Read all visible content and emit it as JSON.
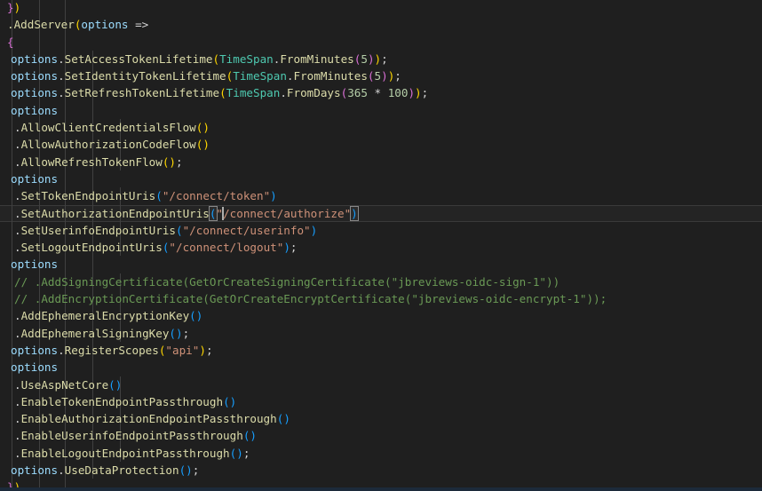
{
  "app": {
    "kind": "code-editor",
    "language": "csharp",
    "theme": "dark-modern",
    "background": "#1f1f1f",
    "foreground": "#d4d4d4"
  },
  "colors": {
    "variable": "#9cdcfe",
    "function": "#dcdcaa",
    "type": "#4ec9b0",
    "string": "#ce9178",
    "number": "#b5cea8",
    "comment": "#6a9955",
    "operator": "#d4d4d4",
    "bracket_level_0": "#ffd700",
    "bracket_level_1": "#da70d6",
    "bracket_level_2": "#179fff",
    "current_line_background": "#242424",
    "current_line_border": "#3a3a3a",
    "indent_guide": "#404040",
    "caret": "#aeafad",
    "status_strip": "#1c2a3a"
  },
  "cursor": {
    "line_index": 12,
    "line_text": ".SetAuthorizationEndpointUris(\"/connect/authorize\")",
    "bracket_match": [
      "(",
      ")"
    ],
    "caret_after": "\""
  },
  "indent_guides_x": [
    13,
    44,
    73,
    104,
    135
  ],
  "code": {
    "lines": [
      "})",
      ".AddServer(options =>",
      "{",
      "    options.SetAccessTokenLifetime(TimeSpan.FromMinutes(5));",
      "    options.SetIdentityTokenLifetime(TimeSpan.FromMinutes(5));",
      "    options.SetRefreshTokenLifetime(TimeSpan.FromDays(365 * 100));",
      "    options",
      "        .AllowClientCredentialsFlow()",
      "        .AllowAuthorizationCodeFlow()",
      "        .AllowRefreshTokenFlow();",
      "    options",
      "        .SetTokenEndpointUris(\"/connect/token\")",
      "        .SetAuthorizationEndpointUris(\"/connect/authorize\")",
      "        .SetUserinfoEndpointUris(\"/connect/userinfo\")",
      "        .SetLogoutEndpointUris(\"/connect/logout\");",
      "    options",
      "        // .AddSigningCertificate(GetOrCreateSigningCertificate(\"jbreviews-oidc-sign-1\"))",
      "        // .AddEncryptionCertificate(GetOrCreateEncryptCertificate(\"jbreviews-oidc-encrypt-1\"));",
      "        .AddEphemeralEncryptionKey()",
      "        .AddEphemeralSigningKey();",
      "    options.RegisterScopes(\"api\");",
      "    options",
      "        .UseAspNetCore()",
      "        .EnableTokenEndpointPassthrough()",
      "        .EnableAuthorizationEndpointPassthrough()",
      "        .EnableUserinfoEndpointPassthrough()",
      "        .EnableLogoutEndpointPassthrough();",
      "    options.UseDataProtection();",
      "})"
    ],
    "tokens": [
      [
        [
          "}",
          "b1"
        ],
        [
          ")",
          "b0"
        ]
      ],
      [
        [
          ".AddServer",
          "fn"
        ],
        [
          "(",
          "b0"
        ],
        [
          "options",
          "var"
        ],
        [
          " =>",
          "op"
        ]
      ],
      [
        [
          "{",
          "b1"
        ]
      ],
      [
        [
          "options",
          "var"
        ],
        [
          ".",
          "op"
        ],
        [
          "SetAccessTokenLifetime",
          "fn"
        ],
        [
          "(",
          "b0"
        ],
        [
          "TimeSpan",
          "type"
        ],
        [
          ".",
          "op"
        ],
        [
          "FromMinutes",
          "fn"
        ],
        [
          "(",
          "b1"
        ],
        [
          "5",
          "num"
        ],
        [
          ")",
          "b1"
        ],
        [
          ")",
          "b0"
        ],
        [
          ";",
          "op"
        ]
      ],
      [
        [
          "options",
          "var"
        ],
        [
          ".",
          "op"
        ],
        [
          "SetIdentityTokenLifetime",
          "fn"
        ],
        [
          "(",
          "b0"
        ],
        [
          "TimeSpan",
          "type"
        ],
        [
          ".",
          "op"
        ],
        [
          "FromMinutes",
          "fn"
        ],
        [
          "(",
          "b1"
        ],
        [
          "5",
          "num"
        ],
        [
          ")",
          "b1"
        ],
        [
          ")",
          "b0"
        ],
        [
          ";",
          "op"
        ]
      ],
      [
        [
          "options",
          "var"
        ],
        [
          ".",
          "op"
        ],
        [
          "SetRefreshTokenLifetime",
          "fn"
        ],
        [
          "(",
          "b0"
        ],
        [
          "TimeSpan",
          "type"
        ],
        [
          ".",
          "op"
        ],
        [
          "FromDays",
          "fn"
        ],
        [
          "(",
          "b1"
        ],
        [
          "365",
          "num"
        ],
        [
          " * ",
          "op"
        ],
        [
          "100",
          "num"
        ],
        [
          ")",
          "b1"
        ],
        [
          ")",
          "b0"
        ],
        [
          ";",
          "op"
        ]
      ],
      [
        [
          "options",
          "var"
        ]
      ],
      [
        [
          ".",
          "op"
        ],
        [
          "AllowClientCredentialsFlow",
          "fn"
        ],
        [
          "(",
          "b0"
        ],
        [
          ")",
          "b0"
        ]
      ],
      [
        [
          ".",
          "op"
        ],
        [
          "AllowAuthorizationCodeFlow",
          "fn"
        ],
        [
          "(",
          "b0"
        ],
        [
          ")",
          "b0"
        ]
      ],
      [
        [
          ".",
          "op"
        ],
        [
          "AllowRefreshTokenFlow",
          "fn"
        ],
        [
          "(",
          "b0"
        ],
        [
          ")",
          "b0"
        ],
        [
          ";",
          "op"
        ]
      ],
      [
        [
          "options",
          "var"
        ]
      ],
      [
        [
          ".",
          "op"
        ],
        [
          "SetTokenEndpointUris",
          "fn"
        ],
        [
          "(",
          "b2"
        ],
        [
          "\"/connect/token\"",
          "str"
        ],
        [
          ")",
          "b2"
        ]
      ],
      [
        [
          ".",
          "op"
        ],
        [
          "SetAuthorizationEndpointUris",
          "fn"
        ],
        [
          "(",
          "b2"
        ],
        [
          "\"/connect/authorize\"",
          "str"
        ],
        [
          ")",
          "b2"
        ]
      ],
      [
        [
          ".",
          "op"
        ],
        [
          "SetUserinfoEndpointUris",
          "fn"
        ],
        [
          "(",
          "b2"
        ],
        [
          "\"/connect/userinfo\"",
          "str"
        ],
        [
          ")",
          "b2"
        ]
      ],
      [
        [
          ".",
          "op"
        ],
        [
          "SetLogoutEndpointUris",
          "fn"
        ],
        [
          "(",
          "b2"
        ],
        [
          "\"/connect/logout\"",
          "str"
        ],
        [
          ")",
          "b2"
        ],
        [
          ";",
          "op"
        ]
      ],
      [
        [
          "options",
          "var"
        ]
      ],
      [
        [
          "// .AddSigningCertificate(GetOrCreateSigningCertificate(\"jbreviews-oidc-sign-1\"))",
          "cmt"
        ]
      ],
      [
        [
          "// .AddEncryptionCertificate(GetOrCreateEncryptCertificate(\"jbreviews-oidc-encrypt-1\"));",
          "cmt"
        ]
      ],
      [
        [
          ".",
          "op"
        ],
        [
          "AddEphemeralEncryptionKey",
          "fn"
        ],
        [
          "(",
          "b2"
        ],
        [
          ")",
          "b2"
        ]
      ],
      [
        [
          ".",
          "op"
        ],
        [
          "AddEphemeralSigningKey",
          "fn"
        ],
        [
          "(",
          "b2"
        ],
        [
          ")",
          "b2"
        ],
        [
          ";",
          "op"
        ]
      ],
      [
        [
          "options",
          "var"
        ],
        [
          ".",
          "op"
        ],
        [
          "RegisterScopes",
          "fn"
        ],
        [
          "(",
          "b0"
        ],
        [
          "\"api\"",
          "str"
        ],
        [
          ")",
          "b0"
        ],
        [
          ";",
          "op"
        ]
      ],
      [
        [
          "options",
          "var"
        ]
      ],
      [
        [
          ".",
          "op"
        ],
        [
          "UseAspNetCore",
          "fn"
        ],
        [
          "(",
          "b2"
        ],
        [
          ")",
          "b2"
        ]
      ],
      [
        [
          ".",
          "op"
        ],
        [
          "EnableTokenEndpointPassthrough",
          "fn"
        ],
        [
          "(",
          "b2"
        ],
        [
          ")",
          "b2"
        ]
      ],
      [
        [
          ".",
          "op"
        ],
        [
          "EnableAuthorizationEndpointPassthrough",
          "fn"
        ],
        [
          "(",
          "b2"
        ],
        [
          ")",
          "b2"
        ]
      ],
      [
        [
          ".",
          "op"
        ],
        [
          "EnableUserinfoEndpointPassthrough",
          "fn"
        ],
        [
          "(",
          "b2"
        ],
        [
          ")",
          "b2"
        ]
      ],
      [
        [
          ".",
          "op"
        ],
        [
          "EnableLogoutEndpointPassthrough",
          "fn"
        ],
        [
          "(",
          "b2"
        ],
        [
          ")",
          "b2"
        ],
        [
          ";",
          "op"
        ]
      ],
      [
        [
          "options",
          "var"
        ],
        [
          ".",
          "op"
        ],
        [
          "UseDataProtection",
          "fn"
        ],
        [
          "(",
          "b2"
        ],
        [
          ")",
          "b2"
        ],
        [
          ";",
          "op"
        ]
      ],
      [
        [
          "}",
          "b1"
        ],
        [
          ")",
          "b0"
        ]
      ]
    ],
    "indents": [
      8,
      8,
      8,
      12,
      12,
      12,
      12,
      16,
      16,
      16,
      12,
      16,
      16,
      16,
      16,
      12,
      16,
      16,
      16,
      16,
      12,
      12,
      16,
      16,
      16,
      16,
      16,
      12,
      8
    ]
  }
}
